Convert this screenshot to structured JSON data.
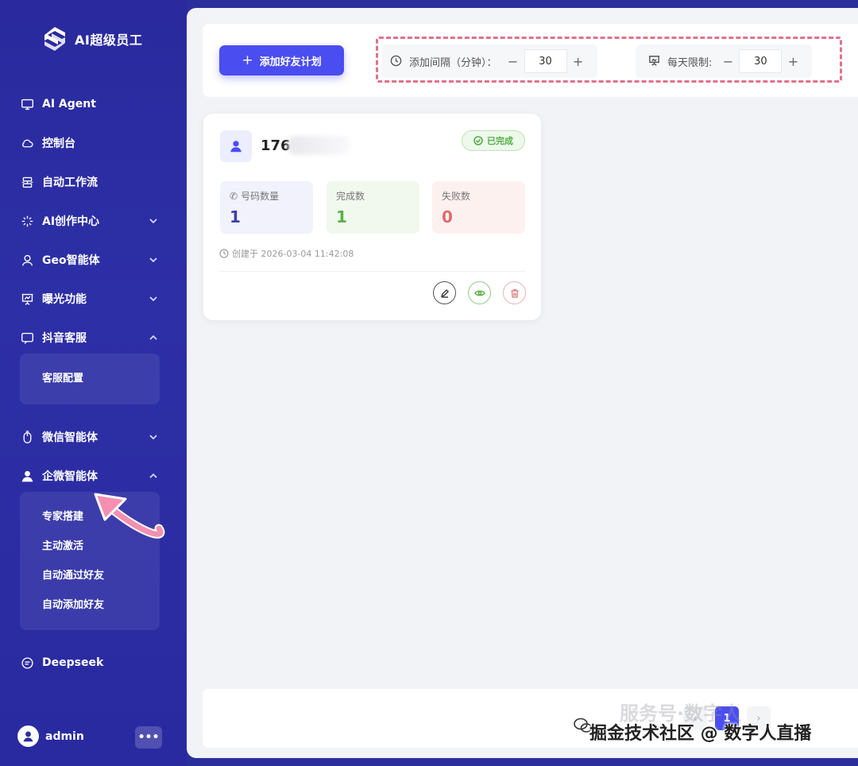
{
  "sidebar": {
    "logo_text": "AI超级员工",
    "items": [
      {
        "label": "AI Agent",
        "icon": "monitor-icon"
      },
      {
        "label": "控制台",
        "icon": "cloud-icon"
      },
      {
        "label": "自动工作流",
        "icon": "workflow-icon"
      },
      {
        "label": "AI创作中心",
        "icon": "sparkle-icon"
      },
      {
        "label": "Geo智能体",
        "icon": "location-user-icon"
      },
      {
        "label": "曝光功能",
        "icon": "presentation-icon"
      },
      {
        "label": "抖音客服",
        "icon": "chat-icon"
      },
      {
        "label": "微信智能体",
        "icon": "mouse-icon"
      },
      {
        "label": "企微智能体",
        "icon": "user-icon"
      },
      {
        "label": "Deepseek",
        "icon": "message-icon"
      }
    ],
    "douyin_sub": [
      "客服配置"
    ],
    "qiwei_sub": [
      "专家搭建",
      "主动激活",
      "自动通过好友",
      "自动添加好友"
    ],
    "user": {
      "name": "admin",
      "more_label": "•••"
    }
  },
  "toolbar": {
    "add_label": "添加好友计划",
    "interval_label": "添加间隔（分钟）：",
    "interval_value": "30",
    "daily_label": "每天限制:",
    "daily_value": "30",
    "minus": "−",
    "plus": "+"
  },
  "card": {
    "title": "176",
    "status": "已完成",
    "stats": [
      {
        "label": "号码数量",
        "value": "1",
        "color": "#3b3fa8",
        "bg": "#f1f2fb"
      },
      {
        "label": "完成数",
        "value": "1",
        "color": "#5cb045",
        "bg": "#f1f9ef"
      },
      {
        "label": "失败数",
        "value": "0",
        "color": "#e06b6b",
        "bg": "#fdf1f0"
      }
    ],
    "created": "创建于 2026-03-04 11:42:08"
  },
  "pager": {
    "prev": "‹",
    "current": "1",
    "next": "›"
  },
  "watermark": {
    "text": "掘金技术社区 @ 数字人直播",
    "faint": "服务号·数字人"
  }
}
